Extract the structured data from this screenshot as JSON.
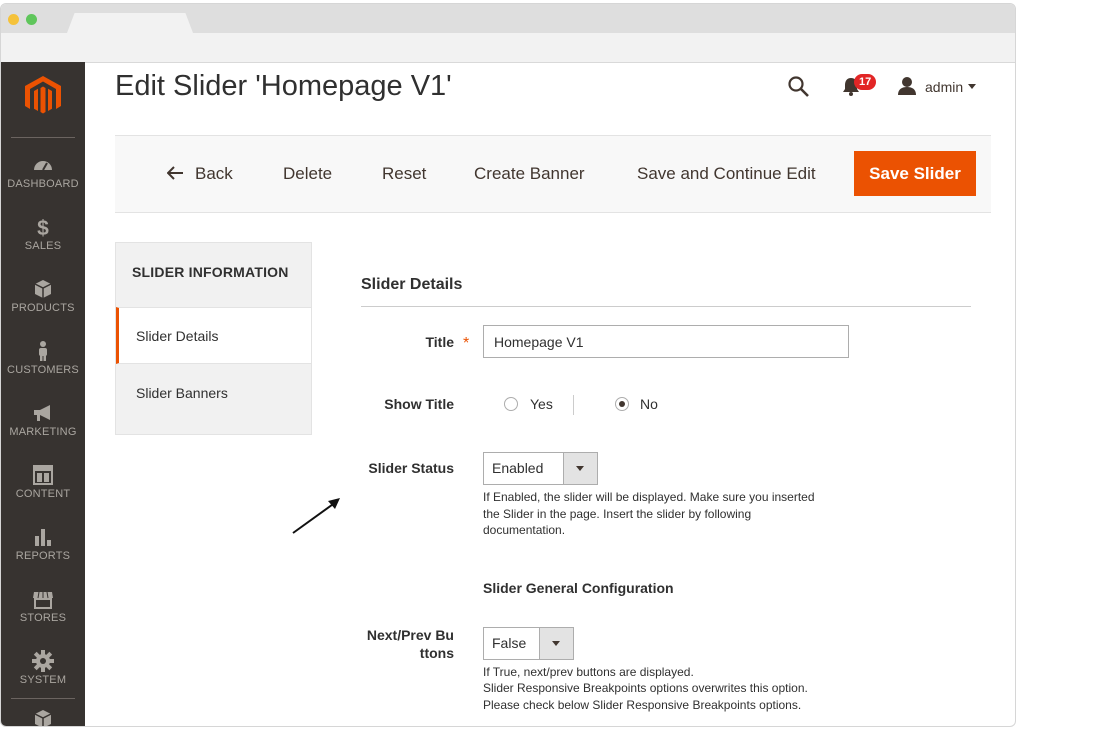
{
  "colors": {
    "accent": "#eb5202",
    "sidebar": "#373330",
    "badge": "#e22626"
  },
  "sidebar": {
    "items": [
      {
        "label": "DASHBOARD",
        "icon": "dashboard-icon"
      },
      {
        "label": "SALES",
        "icon": "dollar-icon"
      },
      {
        "label": "PRODUCTS",
        "icon": "cube-icon"
      },
      {
        "label": "CUSTOMERS",
        "icon": "person-icon"
      },
      {
        "label": "MARKETING",
        "icon": "megaphone-icon"
      },
      {
        "label": "CONTENT",
        "icon": "layout-icon"
      },
      {
        "label": "REPORTS",
        "icon": "bar-chart-icon"
      },
      {
        "label": "STORES",
        "icon": "store-icon"
      },
      {
        "label": "SYSTEM",
        "icon": "gear-icon"
      }
    ]
  },
  "header": {
    "title": "Edit Slider 'Homepage V1'",
    "notifications_count": "17",
    "user_name": "admin"
  },
  "actions": {
    "back": "Back",
    "delete": "Delete",
    "reset": "Reset",
    "create_banner": "Create Banner",
    "save_continue": "Save and Continue Edit",
    "save": "Save Slider"
  },
  "tabs": {
    "heading": "SLIDER INFORMATION",
    "items": [
      "Slider Details",
      "Slider Banners"
    ]
  },
  "form": {
    "section_title": "Slider Details",
    "title_label": "Title",
    "title_value": "Homepage V1",
    "show_title_label": "Show Title",
    "show_title_yes": "Yes",
    "show_title_no": "No",
    "status_label": "Slider Status",
    "status_value": "Enabled",
    "status_note_1": "If Enabled, the slider will be displayed. Make sure you inserted",
    "status_note_2": "the Slider in the page. Insert the slider by following",
    "status_note_3": "documentation.",
    "general_config_title": "Slider General Configuration",
    "nav_label_1": "Next/Prev Bu",
    "nav_label_2": "ttons",
    "nav_value": "False",
    "nav_note_1": "If True, next/prev buttons are displayed.",
    "nav_note_2": "Slider Responsive Breakpoints options overwrites this option.",
    "nav_note_3": "Please check below Slider Responsive Breakpoints options."
  }
}
